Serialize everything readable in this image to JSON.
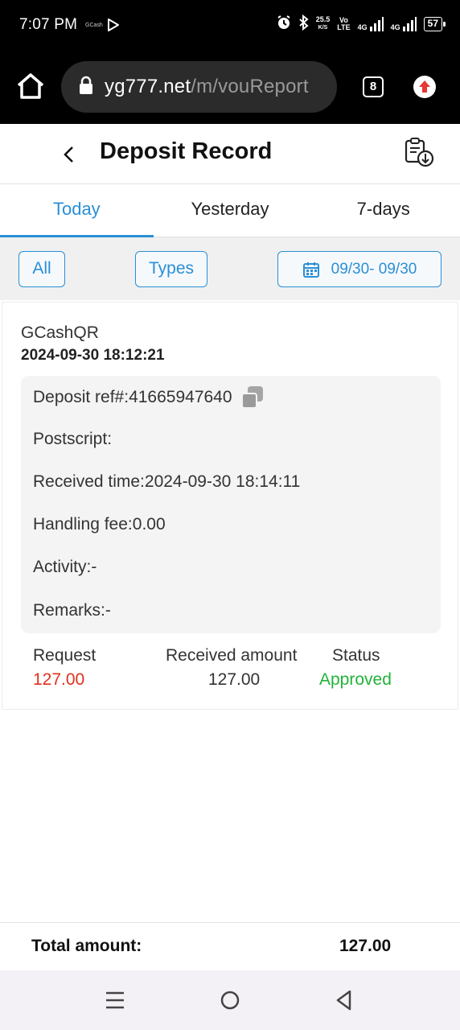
{
  "status_bar": {
    "time": "7:07 PM",
    "app_badge": "GCash",
    "net_speed_value": "25.5",
    "net_speed_unit": "K/S",
    "volte_top": "Vo",
    "volte_bottom": "LTE",
    "sim1_label": "4G",
    "sim2_label": "4G",
    "battery": "57"
  },
  "browser": {
    "url_domain": "yg777.net",
    "url_path": "/m/vouReport",
    "tab_count": "8",
    "upload_color": "#e53935"
  },
  "header": {
    "title": "Deposit Record"
  },
  "tabs": [
    {
      "label": "Today",
      "active": true
    },
    {
      "label": "Yesterday",
      "active": false
    },
    {
      "label": "7-days",
      "active": false
    }
  ],
  "filters": {
    "all_label": "All",
    "types_label": "Types",
    "date_range": "09/30- 09/30"
  },
  "record": {
    "type": "GCashQR",
    "created_time": "2024-09-30 18:12:21",
    "details": [
      {
        "label": "Deposit ref#:",
        "value": "41665947640"
      },
      {
        "label": "Postscript:",
        "value": ""
      },
      {
        "label": "Received time:",
        "value": "2024-09-30 18:14:11"
      },
      {
        "label": "Handling fee:",
        "value": "0.00"
      },
      {
        "label": "Activity:",
        "value": "-"
      },
      {
        "label": "Remarks:",
        "value": "-"
      }
    ],
    "summary": {
      "request_label": "Request",
      "request_value": "127.00",
      "received_label": "Received amount",
      "received_value": "127.00",
      "status_label": "Status",
      "status_value": "Approved"
    }
  },
  "total": {
    "label": "Total amount:",
    "value": "127.00"
  },
  "colors": {
    "accent": "#2a8fd6",
    "request_red": "#e0301e",
    "approved_green": "#22b33a"
  }
}
